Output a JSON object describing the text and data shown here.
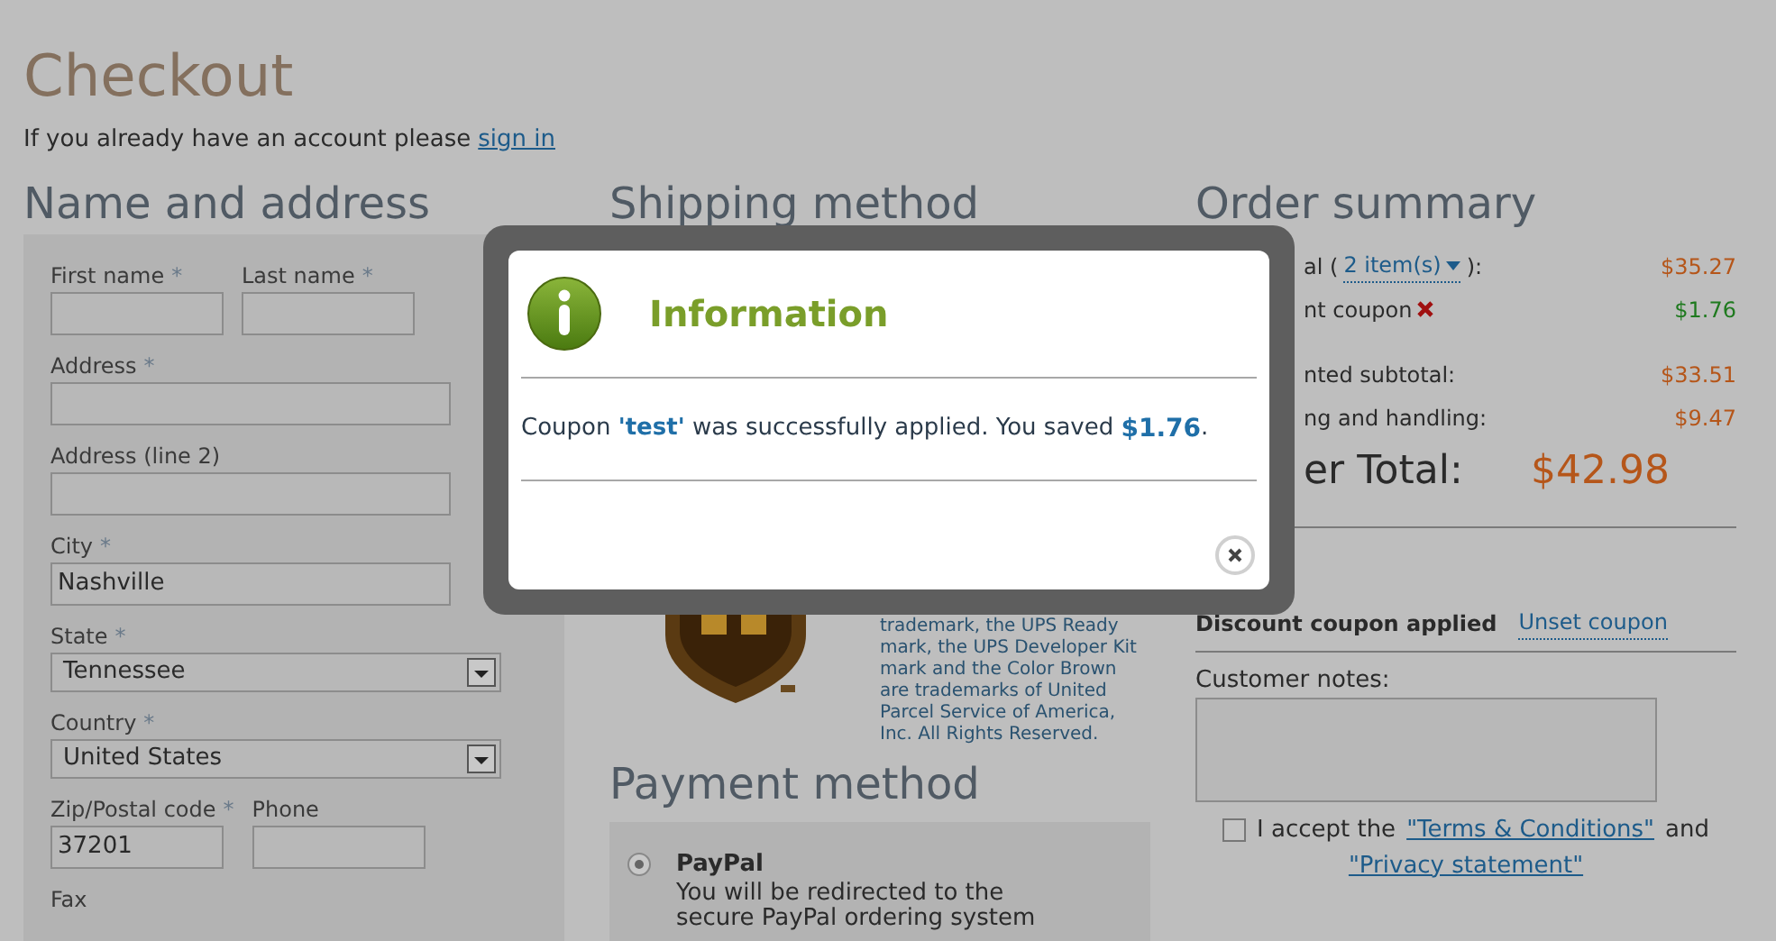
{
  "page": {
    "title": "Checkout",
    "signin_text": "If you already have an account please",
    "signin_link": "sign in"
  },
  "address": {
    "heading": "Name and address",
    "rows": [
      [
        {
          "label": "First name",
          "required_mark": "*",
          "kind": "input"
        },
        {
          "label": "Last name",
          "required_mark": "*",
          "kind": "input"
        }
      ],
      [
        {
          "label": "Address",
          "required_mark": "*",
          "kind": "input"
        }
      ],
      [
        {
          "label": "Address (line 2)",
          "kind": "input"
        }
      ],
      [
        {
          "label": "City",
          "required_mark": "*",
          "value": "Nashville",
          "kind": "input"
        }
      ],
      [
        {
          "label": "State",
          "required_mark": "*",
          "value": "Tennessee",
          "kind": "select"
        }
      ],
      [
        {
          "label": "Country",
          "required_mark": "*",
          "value": "United States",
          "kind": "select"
        }
      ],
      [
        {
          "label": "Zip/Postal code",
          "required_mark": "*",
          "value": "37201",
          "kind": "input"
        },
        {
          "label": "Phone",
          "kind": "input"
        }
      ],
      [
        {
          "label": "Fax",
          "kind": "label"
        }
      ]
    ]
  },
  "shipping": {
    "heading": "Shipping method",
    "notice": "trademark, the UPS Ready mark, the UPS Developer Kit mark and the Color Brown are trademarks of United Parcel Service of America, Inc. All Rights Reserved."
  },
  "payment": {
    "heading": "Payment method",
    "options": [
      {
        "name": "PayPal",
        "description": "You will be redirected to the secure PayPal ordering system",
        "selected": true
      }
    ]
  },
  "summary": {
    "heading": "Order summary",
    "subtotal": {
      "label_start": "al (",
      "items_link": "2 item(s)",
      "label_end": "):",
      "value": "$35.27"
    },
    "coupon": {
      "label": "nt coupon",
      "value": "$1.76"
    },
    "discounted": {
      "label": "nted subtotal:",
      "value": "$33.51"
    },
    "shipping": {
      "label": "ng and handling:",
      "value": "$9.47"
    },
    "total": {
      "label": "er Total:",
      "value": "$42.98"
    },
    "coupon_applied": "Discount coupon applied",
    "unset_link": "Unset coupon",
    "notes_label": "Customer notes:",
    "accept": {
      "checked": false,
      "text": "I accept the",
      "terms_link": "\"Terms & Conditions\"",
      "and": "and",
      "privacy_link": "\"Privacy statement\""
    }
  },
  "dialog": {
    "title": "Information",
    "message_start": "Coupon",
    "code": "'test'",
    "message_mid": "was successfully applied. You saved",
    "amount": "$1.76",
    "message_end": "."
  }
}
